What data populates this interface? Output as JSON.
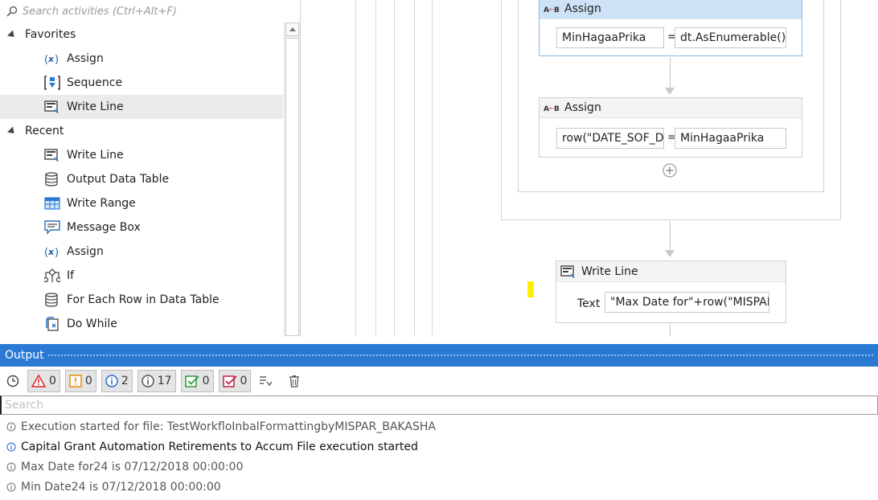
{
  "activities": {
    "search_placeholder": "Search activities (Ctrl+Alt+F)",
    "favorites_label": "Favorites",
    "recent_label": "Recent",
    "favorites": [
      {
        "label": "Assign",
        "icon": "assign-icon"
      },
      {
        "label": "Sequence",
        "icon": "sequence-icon"
      },
      {
        "label": "Write Line",
        "icon": "write-line-icon"
      }
    ],
    "recent": [
      {
        "label": "Write Line",
        "icon": "write-line-icon"
      },
      {
        "label": "Output Data Table",
        "icon": "datatable-icon"
      },
      {
        "label": "Write Range",
        "icon": "write-range-icon"
      },
      {
        "label": "Message Box",
        "icon": "message-box-icon"
      },
      {
        "label": "Assign",
        "icon": "assign-icon"
      },
      {
        "label": "If",
        "icon": "if-icon"
      },
      {
        "label": "For Each Row in Data Table",
        "icon": "datatable-icon"
      },
      {
        "label": "Do While",
        "icon": "do-while-icon"
      }
    ]
  },
  "designer": {
    "assign1": {
      "title": "Assign",
      "to": "MinHagaaPrika",
      "eq": "=",
      "value": "dt.AsEnumerable()."
    },
    "assign2": {
      "title": "Assign",
      "to": "row(\"DATE_SOF_DI",
      "eq": "=",
      "value": "MinHagaaPrika"
    },
    "writeline": {
      "title": "Write Line",
      "text_label": "Text",
      "text_value": "\"Max Date for\"+row(\"MISPAF"
    }
  },
  "output": {
    "title": "Output",
    "counts": {
      "error": "0",
      "warning": "0",
      "info": "2",
      "trace": "17",
      "verbose": "0",
      "critical": "0"
    },
    "search_placeholder": "Search",
    "logs": [
      "Execution started for file: TestWorkfloInbalFormattingbyMISPAR_BAKASHA",
      "Capital Grant Automation Retirements to Accum File execution started",
      "Max Date for24 is 07/12/2018 00:00:00",
      "Min Date24 is 07/12/2018 00:00:00"
    ]
  },
  "colors": {
    "accent": "#2a7ad4",
    "selected_header": "#cde3f5",
    "highlight": "#ffee00"
  }
}
